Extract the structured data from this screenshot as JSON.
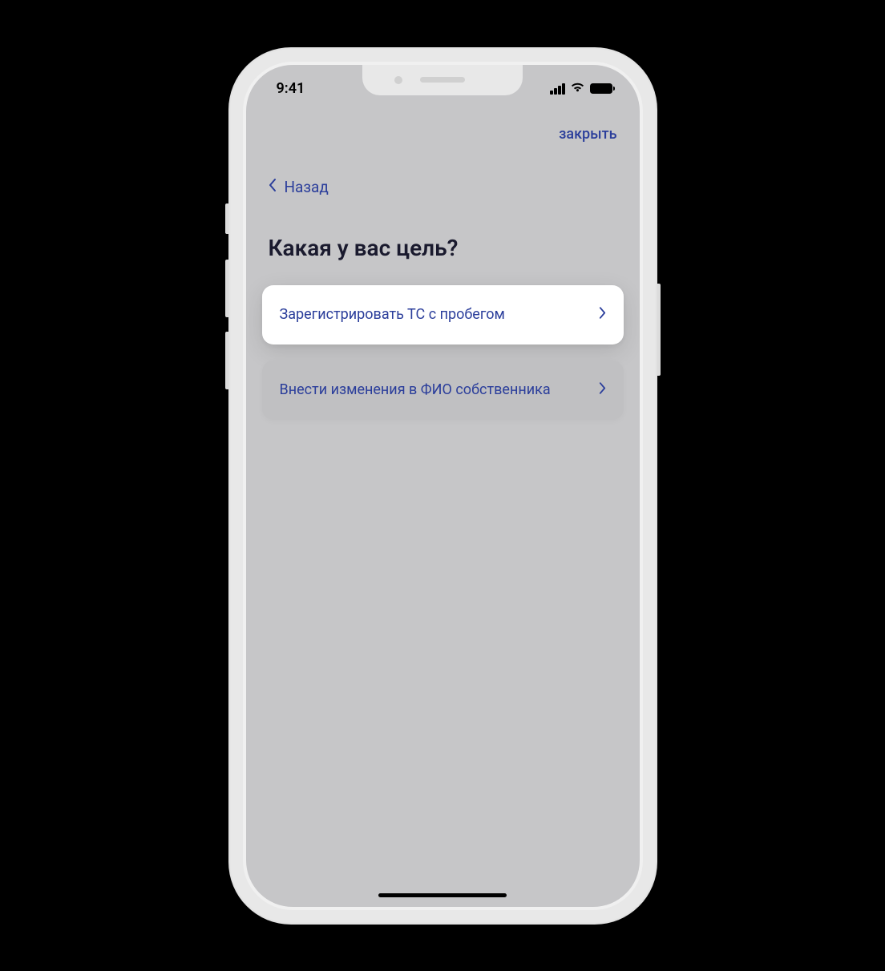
{
  "status_bar": {
    "time": "9:41"
  },
  "header": {
    "close_label": "закрыть"
  },
  "nav": {
    "back_label": "Назад"
  },
  "page": {
    "title": "Какая у вас цель?"
  },
  "options": [
    {
      "label": "Зарегистрировать ТС с пробегом",
      "highlighted": true
    },
    {
      "label": "Внести изменения в ФИО собственника",
      "highlighted": false
    }
  ],
  "colors": {
    "accent": "#2b3e9b",
    "screen_bg": "#c6c6c8"
  }
}
